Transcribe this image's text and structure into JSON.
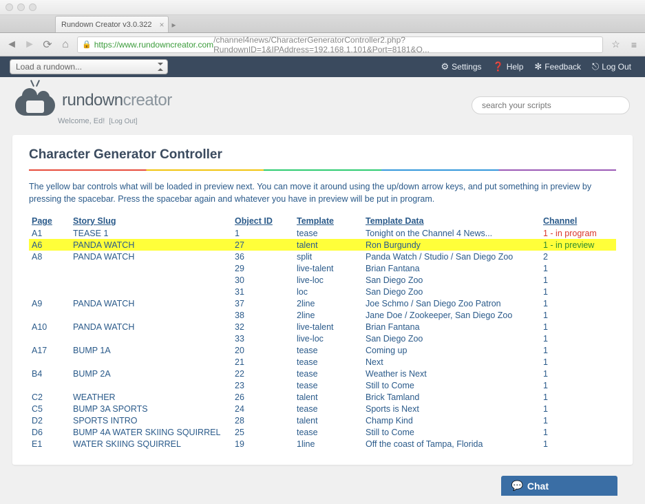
{
  "window": {
    "tab_title": "Rundown Creator v3.0.322"
  },
  "url": {
    "https": "https",
    "domain": "://www.rundowncreator.com",
    "path": "/channel4news/CharacterGeneratorController2.php?RundownID=1&IPAddress=192.168.1.101&Port=8181&O..."
  },
  "toolbar": {
    "rundown_placeholder": "Load a rundown...",
    "settings": "Settings",
    "help": "Help",
    "feedback": "Feedback",
    "logout": "Log Out"
  },
  "brand": {
    "rundown": "rundown",
    "creator": "creator"
  },
  "welcome": {
    "text": "Welcome, Ed!",
    "logout": "[Log Out]"
  },
  "search": {
    "placeholder": "search your scripts"
  },
  "page": {
    "title": "Character Generator Controller",
    "instructions": "The yellow bar controls what will be loaded in preview next. You can move it around using the up/down arrow keys, and put something in preview by pressing the spacebar. Press the spacebar again and whatever you have in preview will be put in program."
  },
  "headers": {
    "page": "Page",
    "slug": "Story Slug",
    "obj": "Object ID",
    "tpl": "Template",
    "data": "Template Data",
    "chan": "Channel"
  },
  "rows": [
    {
      "page": "A1",
      "slug": "TEASE 1",
      "obj": "1",
      "tpl": "tease",
      "data": "Tonight on the Channel 4 News...",
      "chan": "1 - in program",
      "state": "program"
    },
    {
      "page": "A6",
      "slug": "PANDA WATCH",
      "obj": "27",
      "tpl": "talent",
      "data": "Ron Burgundy",
      "chan": "1 - in preview",
      "state": "preview"
    },
    {
      "page": "A8",
      "slug": "PANDA WATCH",
      "obj": "36",
      "tpl": "split",
      "data": "Panda Watch / Studio / San Diego Zoo",
      "chan": "2"
    },
    {
      "page": "",
      "slug": "",
      "obj": "29",
      "tpl": "live-talent",
      "data": "Brian Fantana",
      "chan": "1"
    },
    {
      "page": "",
      "slug": "",
      "obj": "30",
      "tpl": "live-loc",
      "data": "San Diego Zoo",
      "chan": "1"
    },
    {
      "page": "",
      "slug": "",
      "obj": "31",
      "tpl": "loc",
      "data": "San Diego Zoo",
      "chan": "1"
    },
    {
      "page": "A9",
      "slug": "PANDA WATCH",
      "obj": "37",
      "tpl": "2line",
      "data": "Joe Schmo / San Diego Zoo Patron",
      "chan": "1"
    },
    {
      "page": "",
      "slug": "",
      "obj": "38",
      "tpl": "2line",
      "data": "Jane Doe / Zookeeper, San Diego Zoo",
      "chan": "1"
    },
    {
      "page": "A10",
      "slug": "PANDA WATCH",
      "obj": "32",
      "tpl": "live-talent",
      "data": "Brian Fantana",
      "chan": "1"
    },
    {
      "page": "",
      "slug": "",
      "obj": "33",
      "tpl": "live-loc",
      "data": "San Diego Zoo",
      "chan": "1"
    },
    {
      "page": "A17",
      "slug": "BUMP 1A",
      "obj": "20",
      "tpl": "tease",
      "data": "Coming up",
      "chan": "1"
    },
    {
      "page": "",
      "slug": "",
      "obj": "21",
      "tpl": "tease",
      "data": "Next",
      "chan": "1"
    },
    {
      "page": "B4",
      "slug": "BUMP 2A",
      "obj": "22",
      "tpl": "tease",
      "data": "Weather is Next",
      "chan": "1"
    },
    {
      "page": "",
      "slug": "",
      "obj": "23",
      "tpl": "tease",
      "data": "Still to Come",
      "chan": "1"
    },
    {
      "page": "C2",
      "slug": "WEATHER",
      "obj": "26",
      "tpl": "talent",
      "data": "Brick Tamland",
      "chan": "1"
    },
    {
      "page": "C5",
      "slug": "BUMP 3A SPORTS",
      "obj": "24",
      "tpl": "tease",
      "data": "Sports is Next",
      "chan": "1"
    },
    {
      "page": "D2",
      "slug": "SPORTS INTRO",
      "obj": "28",
      "tpl": "talent",
      "data": "Champ Kind",
      "chan": "1"
    },
    {
      "page": "D6",
      "slug": "BUMP 4A WATER SKIING SQUIRREL",
      "obj": "25",
      "tpl": "tease",
      "data": "Still to Come",
      "chan": "1"
    },
    {
      "page": "E1",
      "slug": "WATER SKIING SQUIRREL",
      "obj": "19",
      "tpl": "1line",
      "data": "Off the coast of Tampa, Florida",
      "chan": "1"
    }
  ],
  "chat": {
    "label": "Chat"
  }
}
